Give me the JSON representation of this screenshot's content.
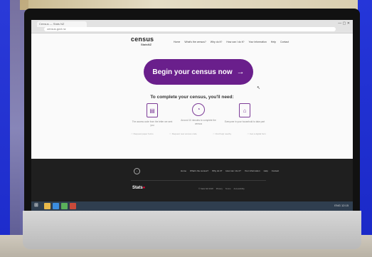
{
  "browser": {
    "tab_title": "Census — Stats NZ",
    "address": "census.govt.nz"
  },
  "site": {
    "logo_primary": "census",
    "logo_secondary": "StatsNZ",
    "nav": [
      "Home",
      "What's the census?",
      "Why do it?",
      "How can I do it?",
      "Your information",
      "Help",
      "Contact"
    ]
  },
  "main": {
    "cta_label": "Begin your census now",
    "cta_arrow": "→",
    "subheading": "To complete your census, you'll need:",
    "requirements": [
      {
        "icon": "document-icon",
        "glyph": "▤",
        "text": "The access code from the letter we sent you"
      },
      {
        "icon": "clock-icon",
        "glyph": "◔",
        "text": "Around 10 minutes to complete the census"
      },
      {
        "icon": "house-icon",
        "glyph": "⌂",
        "text": "Everyone in your household to take part"
      }
    ],
    "links": [
      "Request paper forms",
      "Request new access code",
      "Find help nearby",
      "Get a digital form"
    ]
  },
  "footer": {
    "nav": [
      "Home",
      "What's the census?",
      "Why do it?",
      "How can I do it?",
      "Your information",
      "Help",
      "Contact"
    ],
    "logo": "Stats",
    "legal": [
      "© Stats NZ 2018",
      "Privacy",
      "Terms",
      "Accessibility"
    ]
  },
  "taskbar": {
    "tray": "ENG  12:15"
  },
  "colors": {
    "brand_purple": "#6a1f8c",
    "footer_bg": "#1f1f1f",
    "taskbar_bg": "#2f3e4f"
  }
}
